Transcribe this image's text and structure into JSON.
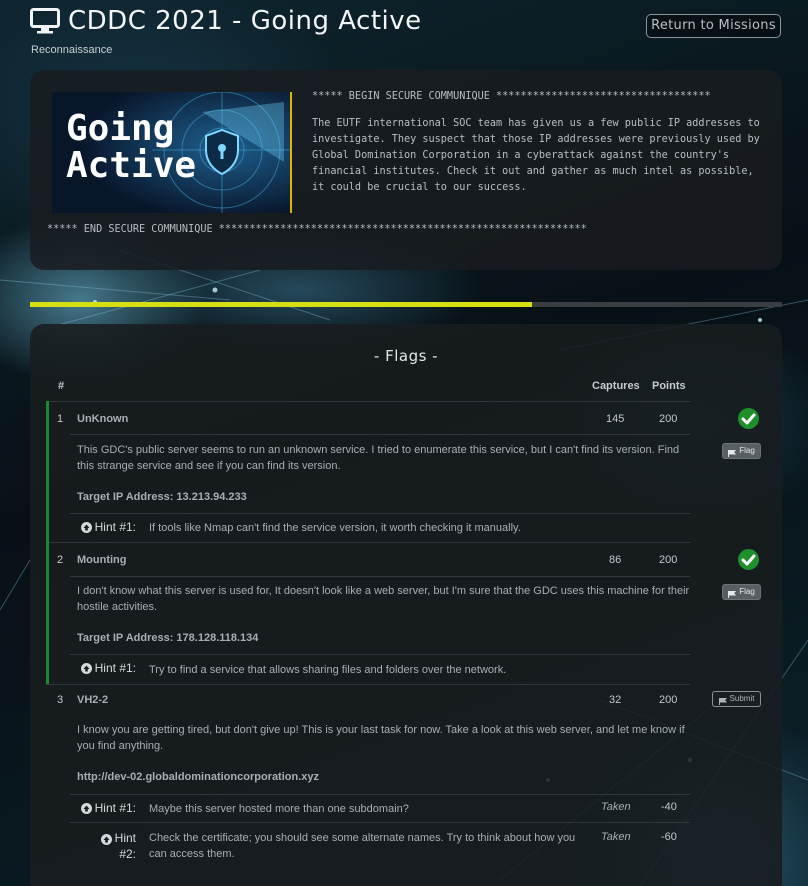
{
  "header": {
    "title": "CDDC 2021 - Going Active",
    "subtitle": "Reconnaissance",
    "return_label": "Return to Missions"
  },
  "briefing": {
    "image_text_line1": "Going",
    "image_text_line2": "Active",
    "begin": "***** BEGIN SECURE COMMUNIQUE ***********************************",
    "body": "The EUTF international SOC team has given us a few public IP addresses to investigate. They suspect that those IP addresses were previously used by Global Domination Corporation in a cyberattack against the country's financial institutes. Check it out and gather as much intel as possible, it could be crucial to our success.",
    "end": "***** END SECURE COMMUNIQUE ************************************************************"
  },
  "progress": {
    "fraction": 0.667,
    "fill_color": "#d5df12"
  },
  "flags": {
    "title": "- Flags -",
    "col_num": "#",
    "col_captures": "Captures",
    "col_points": "Points",
    "rows": [
      {
        "num": "1",
        "name": "UnKnown",
        "captures": "145",
        "points": "200",
        "solved": true,
        "action_label": "Flag",
        "description": "This GDC's public server seems to run an unknown service. I tried to enumerate this service, but I can't find its version. Find this strange service and see if you can find its version.",
        "target": "Target IP Address: 13.213.94.233",
        "hints": [
          {
            "label": "Hint #1:",
            "text": "If tools like Nmap can't find the service version, it worth checking it manually.",
            "status": "",
            "cost": ""
          }
        ]
      },
      {
        "num": "2",
        "name": "Mounting",
        "captures": "86",
        "points": "200",
        "solved": true,
        "action_label": "Flag",
        "description": "I don't know what this server is used for, It doesn't look like a web server, but I'm sure that the GDC uses this machine for their hostile activities.",
        "target": "Target IP Address: 178.128.118.134",
        "hints": [
          {
            "label": "Hint #1:",
            "text": "Try to find a service that allows sharing files and folders over the network.",
            "status": "",
            "cost": ""
          }
        ]
      },
      {
        "num": "3",
        "name": "VH2-2",
        "captures": "32",
        "points": "200",
        "solved": false,
        "action_label": "Submit",
        "description": "I know you are getting tired, but don't give up! This is your last task for now. Take a look at this web server, and let me know if you find anything.",
        "target": "http://dev-02.globaldominationcorporation.xyz",
        "hints": [
          {
            "label": "Hint #1:",
            "text": "Maybe this server hosted more than one subdomain?",
            "status": "Taken",
            "cost": "-40"
          },
          {
            "label_a": "Hint",
            "label_b": "#2:",
            "text": "Check the certificate; you should see some alternate names. Try to think about how you can access them.",
            "status": "Taken",
            "cost": "-60"
          }
        ]
      }
    ]
  }
}
